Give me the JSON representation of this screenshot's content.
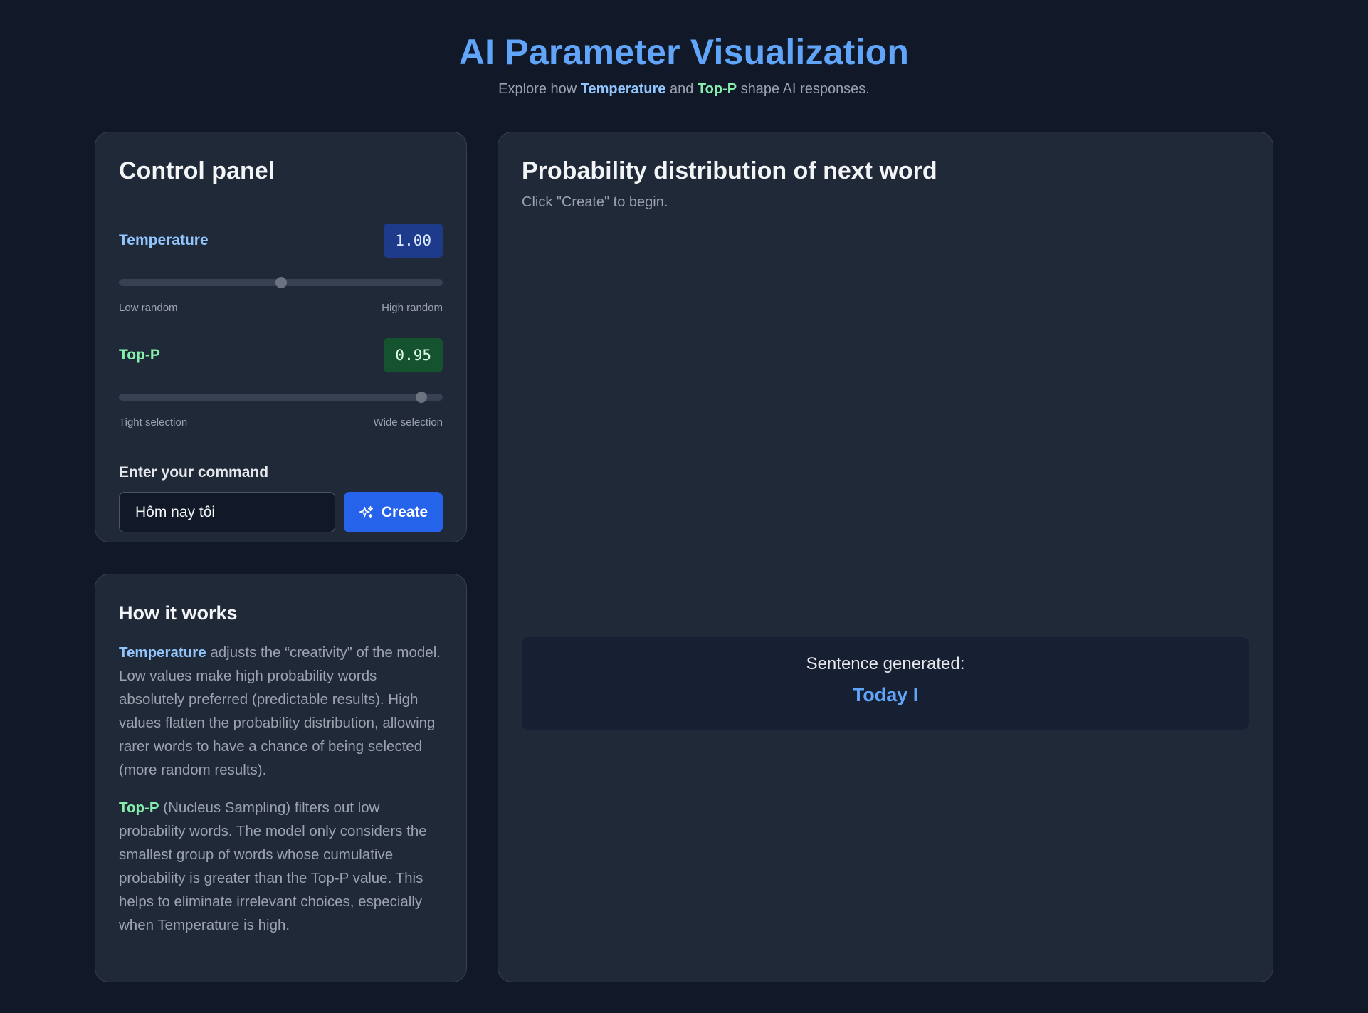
{
  "header": {
    "title": "AI Parameter Visualization",
    "subtitle_prefix": "Explore how ",
    "subtitle_temp": "Temperature",
    "subtitle_and": " and ",
    "subtitle_topp": "Top-P",
    "subtitle_suffix": " shape AI responses."
  },
  "control_panel": {
    "title": "Control panel",
    "temperature": {
      "label": "Temperature",
      "value": "1.00",
      "slider_fraction": 0.5,
      "min_label": "Low random",
      "max_label": "High random"
    },
    "top_p": {
      "label": "Top-P",
      "value": "0.95",
      "slider_fraction": 0.935,
      "min_label": "Tight selection",
      "max_label": "Wide selection"
    },
    "command_label": "Enter your command",
    "command_value": "Hôm nay tôi",
    "create_label": "Create",
    "create_icon": "sparkles-icon"
  },
  "how_it_works": {
    "title": "How it works",
    "p1_keyword": "Temperature",
    "p1_text": " adjusts the “creativity” of the model. Low values make high probability words absolutely preferred (predictable results). High values flatten the probability distribution, allowing rarer words to have a chance of being selected (more random results).",
    "p2_keyword": "Top-P",
    "p2_text": " (Nucleus Sampling) filters out low probability words. The model only considers the smallest group of words whose cumulative probability is greater than the Top-P value. This helps to eliminate irrelevant choices, especially when Temperature is high."
  },
  "distribution": {
    "title": "Probability distribution of next word",
    "hint": "Click \"Create\" to begin.",
    "sentence_label": "Sentence generated:",
    "sentence_text": "Today I"
  },
  "colors": {
    "background": "#111827",
    "card": "#1f2937",
    "accent_blue": "#60a5fa",
    "accent_green": "#86efac",
    "button": "#2563eb"
  }
}
